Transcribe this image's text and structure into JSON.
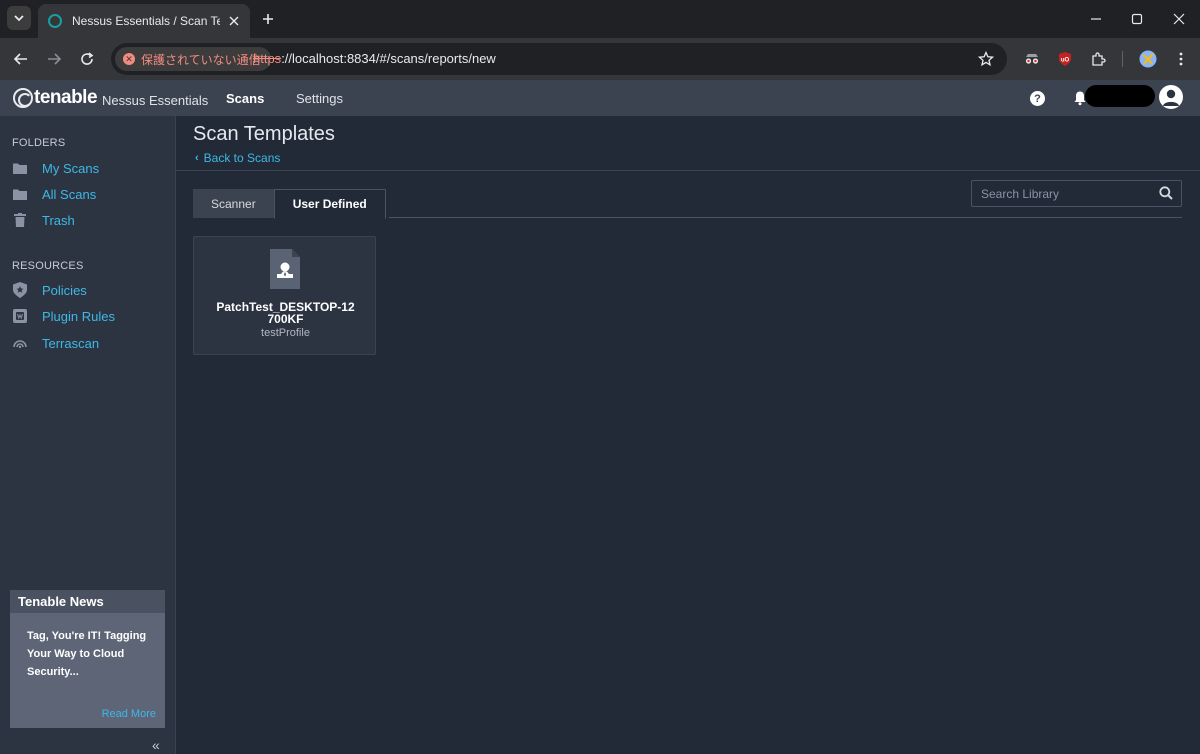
{
  "browser": {
    "tab_title": "Nessus Essentials / Scan Templates",
    "security_label": "保護されていない通信",
    "url_protocol": "https",
    "url_rest": "://localhost:8834/#/scans/reports/new"
  },
  "header": {
    "brand": "tenable",
    "product": "Nessus Essentials",
    "nav": [
      {
        "label": "Scans",
        "active": true
      },
      {
        "label": "Settings",
        "active": false
      }
    ],
    "help_label": "?"
  },
  "sidebar": {
    "folders_heading": "FOLDERS",
    "folders": [
      {
        "label": "My Scans",
        "icon": "folder-icon"
      },
      {
        "label": "All Scans",
        "icon": "folder-icon"
      },
      {
        "label": "Trash",
        "icon": "trash-icon"
      }
    ],
    "resources_heading": "RESOURCES",
    "resources": [
      {
        "label": "Policies",
        "icon": "policy-icon"
      },
      {
        "label": "Plugin Rules",
        "icon": "plugin-icon"
      },
      {
        "label": "Terrascan",
        "icon": "terrascan-icon"
      }
    ],
    "news": {
      "heading": "Tenable News",
      "body": "Tag, You're IT! Tagging Your Way to Cloud Security...",
      "more": "Read More"
    },
    "collapse_glyph": "«"
  },
  "main": {
    "title": "Scan Templates",
    "back_label": "Back to Scans",
    "tabs": [
      {
        "label": "Scanner",
        "active": false
      },
      {
        "label": "User Defined",
        "active": true
      }
    ],
    "search_placeholder": "Search Library",
    "cards": [
      {
        "title": "PatchTest_DESKTOP-12700KF",
        "subtitle": "testProfile"
      }
    ]
  },
  "colors": {
    "accent": "#3eb8e6",
    "header_bg": "#3c4350",
    "sidebar_bg": "#2d3441",
    "main_bg": "#222a38"
  }
}
